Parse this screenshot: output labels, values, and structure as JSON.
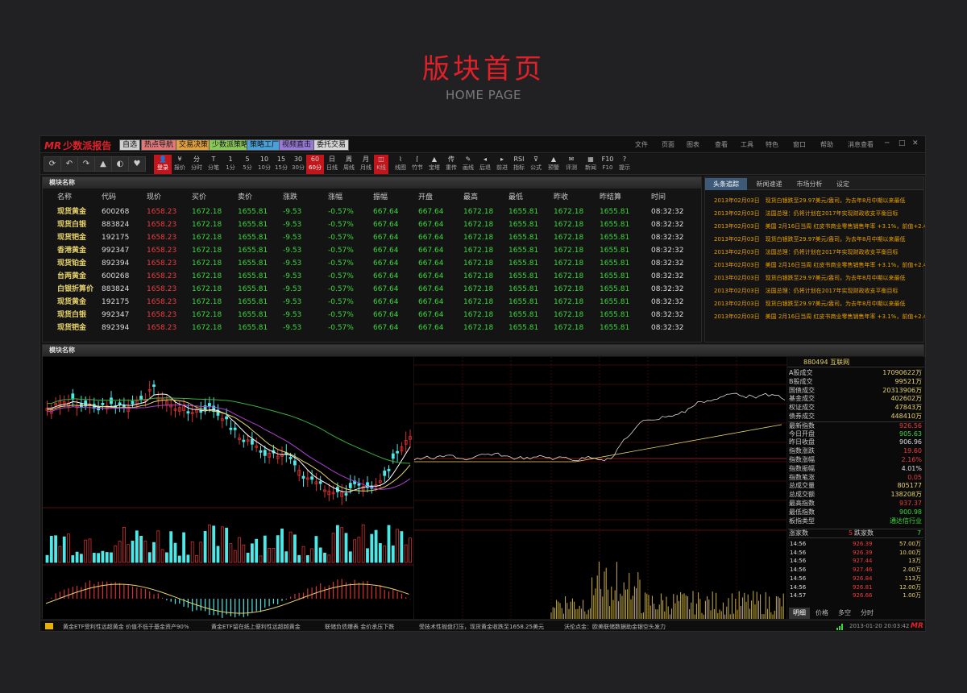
{
  "hero": {
    "title": "版块首页",
    "subtitle": "HOME PAGE"
  },
  "app": {
    "logo": "少数派报告",
    "nav_buttons": [
      {
        "label": "自选",
        "color": "#cfcfcf"
      },
      {
        "label": "热点导航",
        "color": "#e07a7a"
      },
      {
        "label": "交易决策",
        "color": "#e0a040"
      },
      {
        "label": "少数派策略",
        "color": "#8ac85a"
      },
      {
        "label": "策略工厂",
        "color": "#4aa0d8"
      },
      {
        "label": "视频直击",
        "color": "#9a7ad8"
      },
      {
        "label": "委托交易",
        "color": "#d8d8d8"
      }
    ],
    "menu": [
      "文件",
      "页面",
      "图表",
      "查看",
      "工具",
      "特色",
      "窗口",
      "帮助",
      "消息查看"
    ],
    "window_controls": [
      "─",
      "□",
      "✕"
    ]
  },
  "toolbar": {
    "quick_buttons": [
      "refresh-icon",
      "back-icon",
      "forward-icon",
      "up-icon",
      "contrast-icon",
      "heart-icon"
    ],
    "quick_glyphs": [
      "⟳",
      "↶",
      "↷",
      "▲",
      "◐",
      "♥"
    ],
    "items": [
      {
        "glyph": "👤",
        "label": "登录"
      },
      {
        "glyph": "¥",
        "label": "报价"
      },
      {
        "glyph": "分",
        "label": "分时"
      },
      {
        "glyph": "T",
        "label": "分笔"
      },
      {
        "glyph": "1",
        "label": "1分"
      },
      {
        "glyph": "5",
        "label": "5分"
      },
      {
        "glyph": "10",
        "label": "10分"
      },
      {
        "glyph": "15",
        "label": "15分"
      },
      {
        "glyph": "30",
        "label": "30分"
      },
      {
        "glyph": "60",
        "label": "60分"
      },
      {
        "glyph": "日",
        "label": "日线"
      },
      {
        "glyph": "周",
        "label": "周线"
      },
      {
        "glyph": "月",
        "label": "月线"
      },
      {
        "glyph": "◫",
        "label": "K线"
      },
      {
        "glyph": "⌇",
        "label": "线图"
      },
      {
        "glyph": "⌈",
        "label": "竹节"
      },
      {
        "glyph": "▲",
        "label": "宝塔"
      },
      {
        "glyph": "传",
        "label": "重传"
      },
      {
        "glyph": "✎",
        "label": "画线"
      },
      {
        "glyph": "◂",
        "label": "后退"
      },
      {
        "glyph": "▸",
        "label": "前进"
      },
      {
        "glyph": "RSI",
        "label": "指标"
      },
      {
        "glyph": "⊽",
        "label": "公式"
      },
      {
        "glyph": "▲",
        "label": "预警"
      },
      {
        "glyph": "✉",
        "label": "评测"
      },
      {
        "glyph": "▦",
        "label": "新闻"
      },
      {
        "glyph": "F10",
        "label": "F10"
      },
      {
        "glyph": "?",
        "label": "提示"
      }
    ]
  },
  "quote_panel": {
    "title": "模块名称",
    "columns": [
      "名称",
      "代码",
      "现价",
      "买价",
      "卖价",
      "涨跌",
      "涨幅",
      "振幅",
      "开盘",
      "最高",
      "最低",
      "昨收",
      "昨结算",
      "时间"
    ],
    "rows": [
      [
        "现货黄金",
        "600268",
        "1658.23",
        "1672.18",
        "1655.81",
        "-9.53",
        "-0.57%",
        "667.64",
        "667.64",
        "1672.18",
        "1655.81",
        "1672.18",
        "1655.81",
        "08:32:32"
      ],
      [
        "现货白银",
        "883824",
        "1658.23",
        "1672.18",
        "1655.81",
        "-9.53",
        "-0.57%",
        "667.64",
        "667.64",
        "1672.18",
        "1655.81",
        "1672.18",
        "1655.81",
        "08:32:32"
      ],
      [
        "现货钯金",
        "192175",
        "1658.23",
        "1672.18",
        "1655.81",
        "-9.53",
        "-0.57%",
        "667.64",
        "667.64",
        "1672.18",
        "1655.81",
        "1672.18",
        "1655.81",
        "08:32:32"
      ],
      [
        "香港黄金",
        "992347",
        "1658.23",
        "1672.18",
        "1655.81",
        "-9.53",
        "-0.57%",
        "667.64",
        "667.64",
        "1672.18",
        "1655.81",
        "1672.18",
        "1655.81",
        "08:32:32"
      ],
      [
        "现货铂金",
        "892394",
        "1658.23",
        "1672.18",
        "1655.81",
        "-9.53",
        "-0.57%",
        "667.64",
        "667.64",
        "1672.18",
        "1655.81",
        "1672.18",
        "1655.81",
        "08:32:32"
      ],
      [
        "台两黄金",
        "600268",
        "1658.23",
        "1672.18",
        "1655.81",
        "-9.53",
        "-0.57%",
        "667.64",
        "667.64",
        "1672.18",
        "1655.81",
        "1672.18",
        "1655.81",
        "08:32:32"
      ],
      [
        "白银折算价",
        "883824",
        "1658.23",
        "1672.18",
        "1655.81",
        "-9.53",
        "-0.57%",
        "667.64",
        "667.64",
        "1672.18",
        "1655.81",
        "1672.18",
        "1655.81",
        "08:32:32"
      ],
      [
        "现货黄金",
        "192175",
        "1658.23",
        "1672.18",
        "1655.81",
        "-9.53",
        "-0.57%",
        "667.64",
        "667.64",
        "1672.18",
        "1655.81",
        "1672.18",
        "1655.81",
        "08:32:32"
      ],
      [
        "现货白银",
        "992347",
        "1658.23",
        "1672.18",
        "1655.81",
        "-9.53",
        "-0.57%",
        "667.64",
        "667.64",
        "1672.18",
        "1655.81",
        "1672.18",
        "1655.81",
        "08:32:32"
      ],
      [
        "现货钯金",
        "892394",
        "1658.23",
        "1672.18",
        "1655.81",
        "-9.53",
        "-0.57%",
        "667.64",
        "667.64",
        "1672.18",
        "1655.81",
        "1672.18",
        "1655.81",
        "08:32:32"
      ]
    ]
  },
  "news_panel": {
    "tabs": [
      "头条追踪",
      "新闻速递",
      "市场分析",
      "设定"
    ],
    "items": [
      "2013年02月03日　现货白银跌至29.97美元/盎司，为去年8月中期以来最低",
      "2013年02月03日　法国总理：仍将计划在2017年实现财政收支平衡目标",
      "2013年02月03日　美国 2月16日当周 红皮书商业零售销售年率 +3.1%，前值+2.4%",
      "2013年02月03日　现货白银跌至29.97美元/盎司，为去年8月中期以来最低",
      "2013年02月03日　法国总理：仍将计划在2017年实现财政收支平衡目标",
      "2013年02月03日　美国 2月16日当周 红皮书商业零售销售年率 +3.1%，前值+2.4%",
      "2013年02月03日　现货白银跌至29.97美元/盎司，为去年8月中期以来最低",
      "2013年02月03日　法国总理：仍将计划在2017年实现财政收支平衡目标",
      "2013年02月03日　现货白银跌至29.97美元/盎司，为去年8月中期以来最低",
      "2013年02月03日　美国 2月16日当周 红皮书商业零售销售年率 +3.1%，前值+2.4%"
    ]
  },
  "chart_panel": {
    "title": "模块名称"
  },
  "info_panel": {
    "header": "880494 互联网",
    "stats": [
      {
        "k": "A股成交",
        "v": "17090622万",
        "c": "#e8d36a"
      },
      {
        "k": "B股成交",
        "v": "99521万",
        "c": "#e8d36a"
      },
      {
        "k": "国债成交",
        "v": "20313906万",
        "c": "#e8d36a"
      },
      {
        "k": "基金成交",
        "v": "402602万",
        "c": "#e8d36a"
      },
      {
        "k": "权证成交",
        "v": "47843万",
        "c": "#e8d36a"
      },
      {
        "k": "债券成交",
        "v": "448410万",
        "c": "#e8d36a"
      },
      {
        "k": "最新指数",
        "v": "926.56",
        "c": "#f03c3c"
      },
      {
        "k": "今日开盘",
        "v": "905.63",
        "c": "#3bd93b"
      },
      {
        "k": "昨日收盘",
        "v": "906.96",
        "c": "#dddddd"
      },
      {
        "k": "指数涨跌",
        "v": "19.60",
        "c": "#f03c3c"
      },
      {
        "k": "指数涨幅",
        "v": "2.16%",
        "c": "#f03c3c"
      },
      {
        "k": "指数振幅",
        "v": "4.01%",
        "c": "#dddddd"
      },
      {
        "k": "指数笔涨",
        "v": "0.05",
        "c": "#f03c3c"
      },
      {
        "k": "总成交量",
        "v": "805177",
        "c": "#e8d36a"
      },
      {
        "k": "总成交额",
        "v": "138208万",
        "c": "#e8d36a"
      },
      {
        "k": "最高指数",
        "v": "937.37",
        "c": "#f03c3c"
      },
      {
        "k": "最低指数",
        "v": "900.98",
        "c": "#3bd93b"
      },
      {
        "k": "板指类型",
        "v": "通达信行业",
        "c": "#3bd93b"
      }
    ],
    "updown": {
      "up_label": "涨家数",
      "up_val": "5",
      "down_label": "跌家数",
      "down_val": "7"
    },
    "ticks": [
      {
        "t": "14:56",
        "p": "926.39",
        "q": "57.00万"
      },
      {
        "t": "14:56",
        "p": "926.39",
        "q": "10.00万"
      },
      {
        "t": "14:56",
        "p": "927.44",
        "q": "13万"
      },
      {
        "t": "14:56",
        "p": "927.46",
        "q": "2.00万"
      },
      {
        "t": "14:56",
        "p": "926.84",
        "q": "113万"
      },
      {
        "t": "14:56",
        "p": "926.81",
        "q": "12.00万"
      },
      {
        "t": "14:57",
        "p": "926.66",
        "q": "1.00万"
      }
    ],
    "tabs": [
      "明细",
      "价格",
      "多空",
      "分时"
    ]
  },
  "statusbar": {
    "tickers": [
      "黄金ETF受利性远超黄金 价值不低于基金资产90%",
      "黄金ETF留在纸上便利性远超越黄金",
      "联储负债爆表 金价承压下跌",
      "受技术性抛盘打压，现货黄金收跌至1658.25美元",
      "沃伦点金：欧美联储数据助金银空头发力"
    ],
    "datetime": "2013-01-20 20:03:42"
  },
  "colors": {
    "accent_red": "#e0212a",
    "up_red": "#f03c3c",
    "down_cyan": "#4de8e8",
    "text_yellow": "#e8d36a",
    "news_orange": "#e8a000"
  }
}
